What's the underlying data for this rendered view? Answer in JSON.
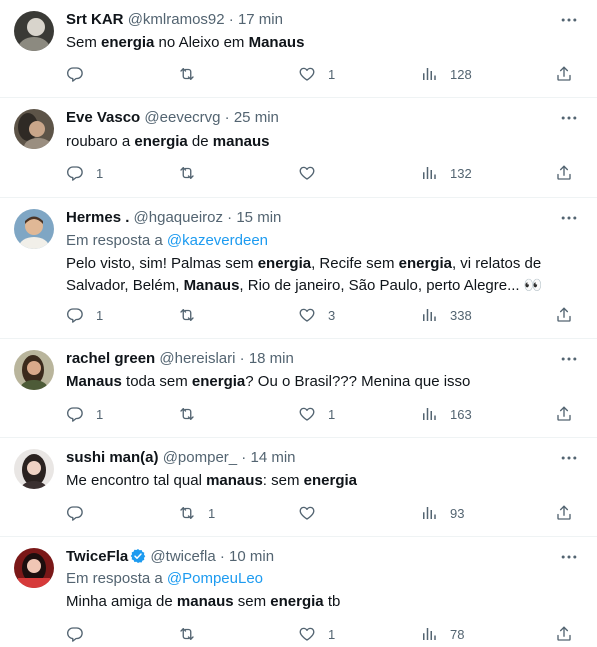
{
  "tweets": [
    {
      "name": "Srt KAR",
      "handle": "@kmlramos92",
      "sep": " · ",
      "time": "17 min",
      "reply_prefix": "",
      "reply_handle": "",
      "text": [
        {
          "t": "Sem ",
          "b": false
        },
        {
          "t": "energia",
          "b": true
        },
        {
          "t": " no Aleixo em ",
          "b": false
        },
        {
          "t": "Manaus",
          "b": true
        }
      ],
      "counts": {
        "replies": "",
        "retweets": "",
        "likes": "1",
        "views": "128"
      }
    },
    {
      "name": "Eve Vasco",
      "handle": "@eevecrvg",
      "sep": " · ",
      "time": "25 min",
      "reply_prefix": "",
      "reply_handle": "",
      "text": [
        {
          "t": "roubaro a ",
          "b": false
        },
        {
          "t": "energia",
          "b": true
        },
        {
          "t": " de ",
          "b": false
        },
        {
          "t": "manaus",
          "b": true
        }
      ],
      "counts": {
        "replies": "1",
        "retweets": "",
        "likes": "",
        "views": "132"
      }
    },
    {
      "name": "Hermes .",
      "handle": "@hgaqueiroz",
      "sep": " · ",
      "time": "15 min",
      "reply_prefix": "Em resposta a ",
      "reply_handle": "@kazeverdeen",
      "text": [
        {
          "t": "Pelo visto, sim! Palmas sem ",
          "b": false
        },
        {
          "t": "energia",
          "b": true
        },
        {
          "t": ", Recife sem ",
          "b": false
        },
        {
          "t": "energia",
          "b": true
        },
        {
          "t": ", vi relatos de Salvador, Belém, ",
          "b": false
        },
        {
          "t": "Manaus",
          "b": true
        },
        {
          "t": ", Rio de janeiro, São Paulo, perto Alegre... 👀",
          "b": false
        }
      ],
      "counts": {
        "replies": "1",
        "retweets": "",
        "likes": "3",
        "views": "338"
      }
    },
    {
      "name": "rachel green",
      "handle": "@hereislari",
      "sep": " · ",
      "time": "18 min",
      "reply_prefix": "",
      "reply_handle": "",
      "text": [
        {
          "t": "Manaus",
          "b": true
        },
        {
          "t": " toda sem ",
          "b": false
        },
        {
          "t": "energia",
          "b": true
        },
        {
          "t": "? Ou o Brasil??? Menina que isso",
          "b": false
        }
      ],
      "counts": {
        "replies": "1",
        "retweets": "",
        "likes": "1",
        "views": "163"
      }
    },
    {
      "name": "sushi man(a)",
      "handle": "@pomper_",
      "sep": " · ",
      "time": "14 min",
      "reply_prefix": "",
      "reply_handle": "",
      "text": [
        {
          "t": "Me encontro tal qual ",
          "b": false
        },
        {
          "t": "manaus",
          "b": true
        },
        {
          "t": ": sem ",
          "b": false
        },
        {
          "t": "energia",
          "b": true
        }
      ],
      "counts": {
        "replies": "",
        "retweets": "1",
        "likes": "",
        "views": "93"
      }
    },
    {
      "name": "TwiceFla",
      "handle": "@twicefla",
      "sep": " · ",
      "time": "10 min",
      "verified": true,
      "reply_prefix": "Em resposta a ",
      "reply_handle": "@PompeuLeo",
      "text": [
        {
          "t": "Minha amiga de ",
          "b": false
        },
        {
          "t": "manaus",
          "b": true
        },
        {
          "t": " sem ",
          "b": false
        },
        {
          "t": "energia",
          "b": true
        },
        {
          "t": " tb",
          "b": false
        }
      ],
      "counts": {
        "replies": "",
        "retweets": "",
        "likes": "1",
        "views": "78"
      }
    }
  ],
  "colors": {
    "text": "#0f1419",
    "muted": "#536471",
    "link": "#1d9bf0",
    "verified": "#1d9bf0",
    "divider": "#eff3f4"
  },
  "icons": [
    "reply-icon",
    "retweet-icon",
    "like-icon",
    "views-icon",
    "share-icon",
    "more-icon",
    "verified-badge-icon"
  ]
}
